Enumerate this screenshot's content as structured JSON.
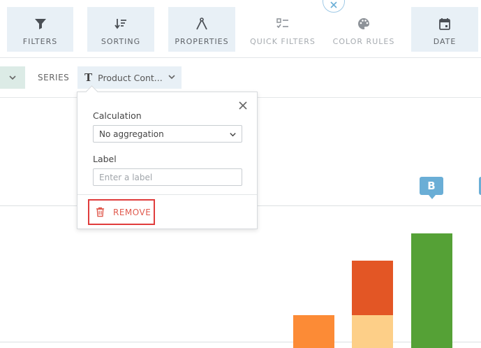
{
  "toolbar": {
    "buttons": [
      {
        "label": "FILTERS",
        "icon": "filter-icon"
      },
      {
        "label": "SORTING",
        "icon": "sort-icon"
      },
      {
        "label": "PROPERTIES",
        "icon": "compass-icon"
      },
      {
        "label": "QUICK FILTERS",
        "icon": "checklist-icon"
      },
      {
        "label": "COLOR RULES",
        "icon": "palette-icon"
      },
      {
        "label": "DATE",
        "icon": "calendar-icon"
      }
    ]
  },
  "series_row": {
    "series_label": "SERIES",
    "field_pill": {
      "type_icon": "T",
      "text": "Product Cont..."
    }
  },
  "popover": {
    "calculation_label": "Calculation",
    "calculation_value": "No aggregation",
    "label_label": "Label",
    "label_placeholder": "Enter a label",
    "label_value": "",
    "remove_label": "REMOVE"
  },
  "chart": {
    "badge_label": "B",
    "colors": {
      "orange": "#fc8b36",
      "light_orange": "#fdcf88",
      "red_orange": "#e35625",
      "green": "#55a136",
      "badge": "#6aaed6"
    }
  }
}
